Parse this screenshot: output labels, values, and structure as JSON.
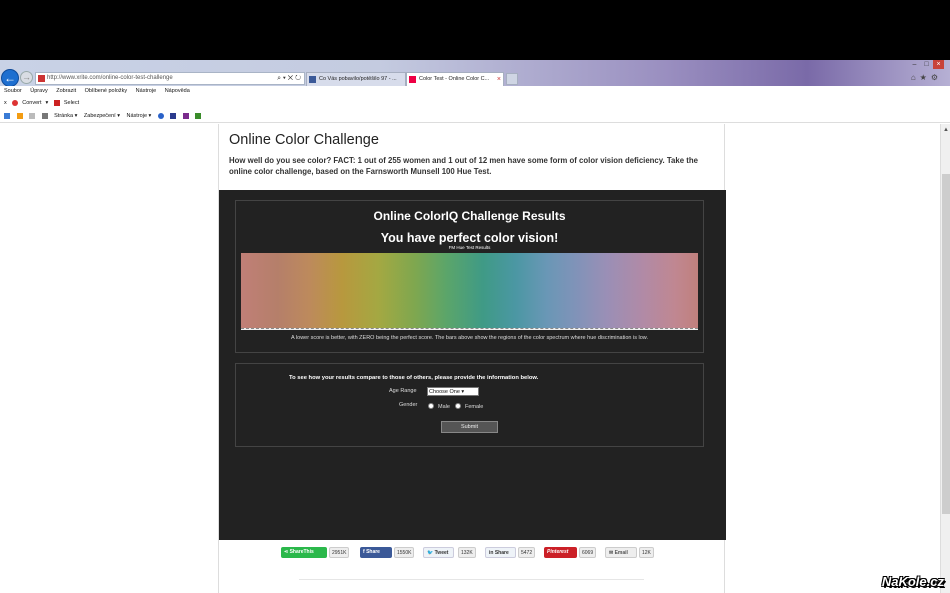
{
  "browser": {
    "address": "http://www.xrite.com/online-color-test-challenge",
    "tabs": [
      {
        "label": "Co Vás pobavilo/potěšilo 97 - ..."
      },
      {
        "label": "Color Test - Online Color C..."
      }
    ],
    "menu": [
      "Soubor",
      "Úpravy",
      "Zobrazit",
      "Oblíbené položky",
      "Nástroje",
      "Nápověda"
    ],
    "favbar": {
      "close": "x",
      "convert": "Convert",
      "select": "Select"
    },
    "commandbar": [
      "Stránka ▾",
      "Zabezpečení ▾",
      "Nástroje ▾"
    ]
  },
  "page": {
    "title": "Online Color Challenge",
    "intro": "How well do you see color? FACT: 1 out of 255 women and 1 out of 12 men have some form of color vision deficiency. Take the online color challenge, based on the Farnsworth Munsell 100 Hue Test.",
    "results": {
      "title": "Online ColorIQ Challenge Results",
      "subtitle": "You have perfect color vision!",
      "chart_label": "FM Hue Test Results",
      "footnote": "A lower score is better, with ZERO being the perfect score. The bars above show the regions of the color spectrum where hue discrimination is low."
    },
    "compare": {
      "lead": "To see how your results compare to those of others, please provide the information below.",
      "age_label": "Age Range",
      "age_value": "Choose One ▾",
      "gender_label": "Gender",
      "male": "Male",
      "female": "Female",
      "submit": "Submit"
    },
    "social": [
      {
        "label": "ShareThis",
        "count": "2951K",
        "color": "#2bb84b"
      },
      {
        "label": "Share",
        "count": "1550K",
        "color": "#3b5998"
      },
      {
        "label": "Tweet",
        "count": "132K",
        "color": "#eef3f8"
      },
      {
        "label": "Share",
        "count": "5472",
        "color": "#eef3f8"
      },
      {
        "label": "Pinterest",
        "count": "6069",
        "color": "#cb2027"
      },
      {
        "label": "Email",
        "count": "12K",
        "color": "#eeeeee"
      }
    ]
  },
  "watermark": "NaKole.cz"
}
